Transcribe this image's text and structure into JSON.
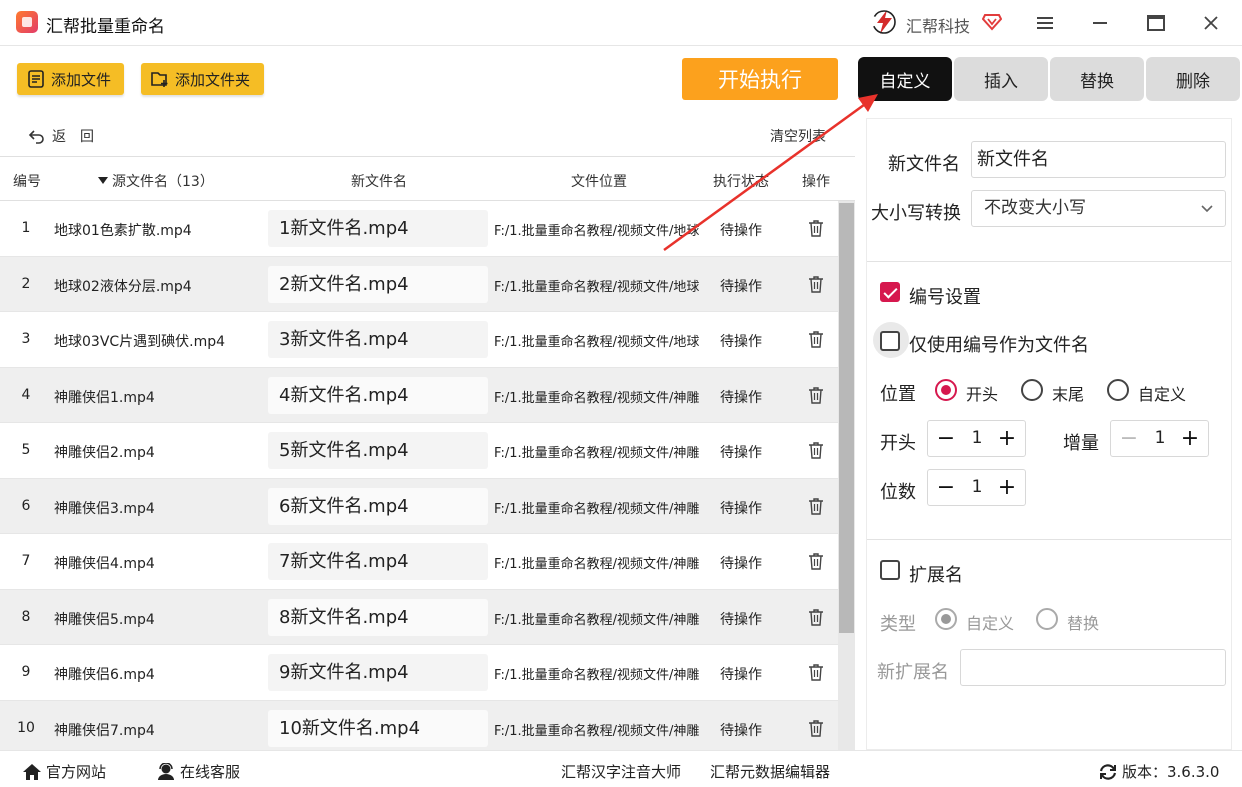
{
  "app": {
    "title": "汇帮批量重命名",
    "brand": "汇帮科技"
  },
  "toolbar": {
    "add_file": "添加文件",
    "add_folder": "添加文件夹",
    "start": "开始执行"
  },
  "tabs": [
    {
      "label": "自定义",
      "active": true
    },
    {
      "label": "插入",
      "active": false
    },
    {
      "label": "替换",
      "active": false
    },
    {
      "label": "删除",
      "active": false
    }
  ],
  "list": {
    "back": "返回",
    "clear": "清空列表",
    "headers": {
      "num": "编号",
      "src": "源文件名（13）",
      "new": "新文件名",
      "loc": "文件位置",
      "status": "执行状态",
      "ops": "操作"
    },
    "rows": [
      {
        "num": "1",
        "src": "地球01色素扩散.mp4",
        "new": "1新文件名.mp4",
        "loc": "F:/1.批量重命名教程/视频文件/地球",
        "status": "待操作"
      },
      {
        "num": "2",
        "src": "地球02液体分层.mp4",
        "new": "2新文件名.mp4",
        "loc": "F:/1.批量重命名教程/视频文件/地球",
        "status": "待操作"
      },
      {
        "num": "3",
        "src": "地球03VC片遇到碘伏.mp4",
        "new": "3新文件名.mp4",
        "loc": "F:/1.批量重命名教程/视频文件/地球",
        "status": "待操作"
      },
      {
        "num": "4",
        "src": "神雕侠侣1.mp4",
        "new": "4新文件名.mp4",
        "loc": "F:/1.批量重命名教程/视频文件/神雕",
        "status": "待操作"
      },
      {
        "num": "5",
        "src": "神雕侠侣2.mp4",
        "new": "5新文件名.mp4",
        "loc": "F:/1.批量重命名教程/视频文件/神雕",
        "status": "待操作"
      },
      {
        "num": "6",
        "src": "神雕侠侣3.mp4",
        "new": "6新文件名.mp4",
        "loc": "F:/1.批量重命名教程/视频文件/神雕",
        "status": "待操作"
      },
      {
        "num": "7",
        "src": "神雕侠侣4.mp4",
        "new": "7新文件名.mp4",
        "loc": "F:/1.批量重命名教程/视频文件/神雕",
        "status": "待操作"
      },
      {
        "num": "8",
        "src": "神雕侠侣5.mp4",
        "new": "8新文件名.mp4",
        "loc": "F:/1.批量重命名教程/视频文件/神雕",
        "status": "待操作"
      },
      {
        "num": "9",
        "src": "神雕侠侣6.mp4",
        "new": "9新文件名.mp4",
        "loc": "F:/1.批量重命名教程/视频文件/神雕",
        "status": "待操作"
      },
      {
        "num": "10",
        "src": "神雕侠侣7.mp4",
        "new": "10新文件名.mp4",
        "loc": "F:/1.批量重命名教程/视频文件/神雕",
        "status": "待操作"
      }
    ]
  },
  "panel": {
    "new_name_label": "新文件名",
    "new_name_value": "新文件名",
    "case_label": "大小写转换",
    "case_value": "不改变大小写",
    "numbering_label": "编号设置",
    "numbering_checked": true,
    "only_number_label": "仅使用编号作为文件名",
    "only_number_checked": false,
    "position_label": "位置",
    "position_options": [
      "开头",
      "末尾",
      "自定义"
    ],
    "position_selected": "开头",
    "start_label": "开头",
    "start_value": "1",
    "increment_label": "增量",
    "increment_value": "1",
    "digits_label": "位数",
    "digits_value": "1",
    "ext_label": "扩展名",
    "ext_checked": false,
    "type_label": "类型",
    "type_options": [
      "自定义",
      "替换"
    ],
    "type_selected": "自定义",
    "new_ext_label": "新扩展名",
    "new_ext_value": ""
  },
  "statusbar": {
    "website": "官方网站",
    "support": "在线客服",
    "app1": "汇帮汉字注音大师",
    "app2": "汇帮元数据编辑器",
    "version": "版本：3.6.3.0"
  },
  "colors": {
    "accent": "#d6184e",
    "start": "#fca11d",
    "yellow": "#f5bd25",
    "arrow": "#e8322b"
  }
}
